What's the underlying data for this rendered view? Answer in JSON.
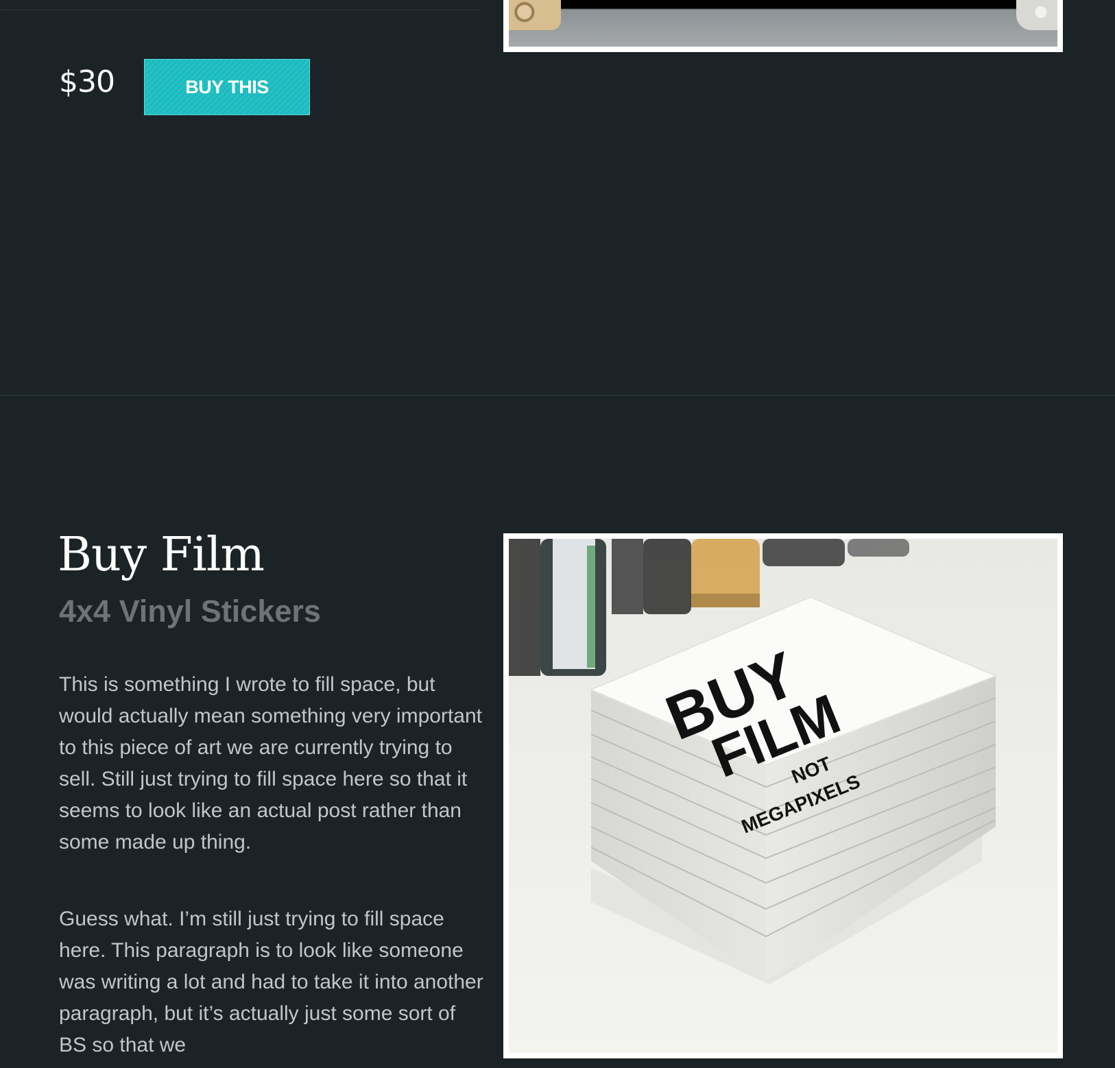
{
  "previous_product": {
    "price": "$30",
    "buy_label": "BUY THIS"
  },
  "product": {
    "title": "Buy Film",
    "subtitle": "4x4 Vinyl Stickers",
    "paragraphs": [
      "This is something I wrote to fill space, but would actually mean something very important to this piece of art we are currently trying to sell. Still just trying to fill space here so that it seems to look like an actual post rather than some made up thing.",
      "Guess what. I’m still just trying to fill space here. This paragraph is to look like someone was writing a lot and had to take it into another paragraph, but it’s actually just some sort of BS so that we"
    ],
    "sticker_text": {
      "line1": "BUY",
      "line2": "FILM",
      "line3": "NOT",
      "line4": "MEGAPIXELS"
    }
  },
  "colors": {
    "background": "#1c2327",
    "accent": "#22c2c6",
    "subtitle": "#6c7479",
    "body_text": "#c2c6c8"
  }
}
